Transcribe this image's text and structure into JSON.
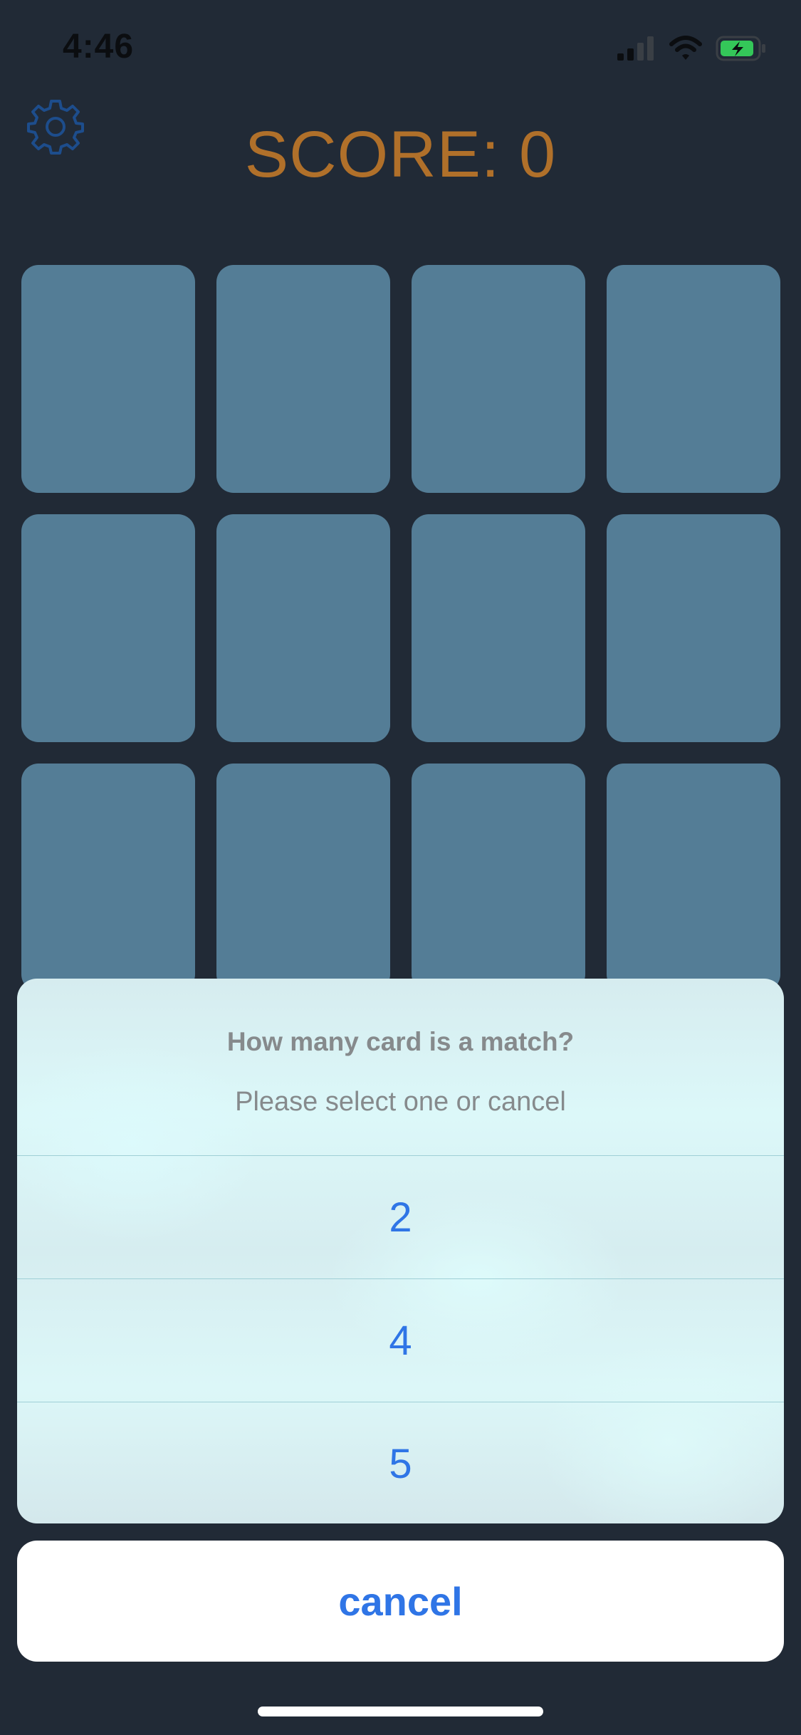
{
  "status_bar": {
    "time": "4:46",
    "icons": [
      "cellular-signal-icon",
      "wifi-icon",
      "battery-charging-icon"
    ]
  },
  "settings_icon": "gear-icon",
  "score_label": "SCORE: 0",
  "cards": {
    "rows": 3,
    "columns": 4,
    "count": 12,
    "state": "face-down"
  },
  "action_sheet": {
    "title": "How many card is a match?",
    "message": "Please select one or cancel",
    "options": [
      "2",
      "4",
      "5"
    ],
    "cancel_label": "cancel"
  },
  "colors": {
    "background": "#212a36",
    "card_back": "#547d96",
    "score_text": "#b0702a",
    "gear_icon": "#1d4d8c",
    "action_text": "#2f75e6",
    "sheet_text": "#868a8c",
    "battery_fill": "#34c759"
  }
}
